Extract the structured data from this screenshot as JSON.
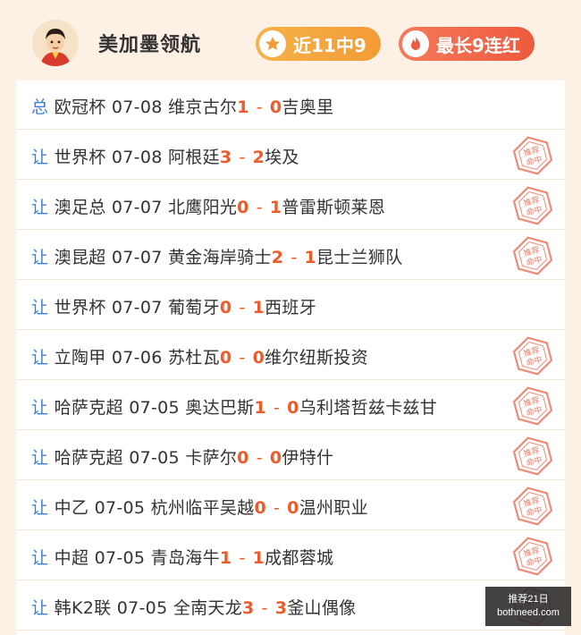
{
  "header": {
    "expert_name": "美加墨领航",
    "recent_hits": "近11中9",
    "longest_streak": "最长9连红"
  },
  "matches": [
    {
      "tag": "总",
      "league": "欧冠杯",
      "date": "07-08",
      "home": "维京古尔",
      "home_score": "1",
      "away_score": "0",
      "away": "吉奥里",
      "hit_stamp": false
    },
    {
      "tag": "让",
      "league": "世界杯",
      "date": "07-08",
      "home": "阿根廷",
      "home_score": "3",
      "away_score": "2",
      "away": "埃及",
      "hit_stamp": true
    },
    {
      "tag": "让",
      "league": "澳足总",
      "date": "07-07",
      "home": "北鹰阳光",
      "home_score": "0",
      "away_score": "1",
      "away": "普雷斯顿莱恩",
      "hit_stamp": true
    },
    {
      "tag": "让",
      "league": "澳昆超",
      "date": "07-07",
      "home": "黄金海岸骑士",
      "home_score": "2",
      "away_score": "1",
      "away": "昆士兰狮队",
      "hit_stamp": true
    },
    {
      "tag": "让",
      "league": "世界杯",
      "date": "07-07",
      "home": "葡萄牙",
      "home_score": "0",
      "away_score": "1",
      "away": "西班牙",
      "hit_stamp": false
    },
    {
      "tag": "让",
      "league": "立陶甲",
      "date": "07-06",
      "home": "苏杜瓦",
      "home_score": "0",
      "away_score": "0",
      "away": "维尔纽斯投资",
      "hit_stamp": true
    },
    {
      "tag": "让",
      "league": "哈萨克超",
      "date": "07-05",
      "home": "奥达巴斯",
      "home_score": "1",
      "away_score": "0",
      "away": "乌利塔哲兹卡兹甘",
      "hit_stamp": true
    },
    {
      "tag": "让",
      "league": "哈萨克超",
      "date": "07-05",
      "home": "卡萨尔",
      "home_score": "0",
      "away_score": "0",
      "away": "伊特什",
      "hit_stamp": true
    },
    {
      "tag": "让",
      "league": "中乙",
      "date": "07-05",
      "home": "杭州临平吴越",
      "home_score": "0",
      "away_score": "0",
      "away": "温州职业",
      "hit_stamp": true
    },
    {
      "tag": "让",
      "league": "中超",
      "date": "07-05",
      "home": "青岛海牛",
      "home_score": "1",
      "away_score": "1",
      "away": "成都蓉城",
      "hit_stamp": true
    },
    {
      "tag": "让",
      "league": "韩K2联",
      "date": "07-05",
      "home": "全南天龙",
      "home_score": "3",
      "away_score": "3",
      "away": "釜山偶像",
      "hit_stamp": true
    }
  ],
  "stamp_text": "推荐命中",
  "dash": "-",
  "watermark": {
    "line1": "推荐21日",
    "line2": "bothneed.com"
  },
  "colors": {
    "accent": "#ee5a28",
    "tag": "#3d7fd6",
    "hit_pill": "#f6b24a",
    "streak_pill": "#ee5a3d"
  }
}
